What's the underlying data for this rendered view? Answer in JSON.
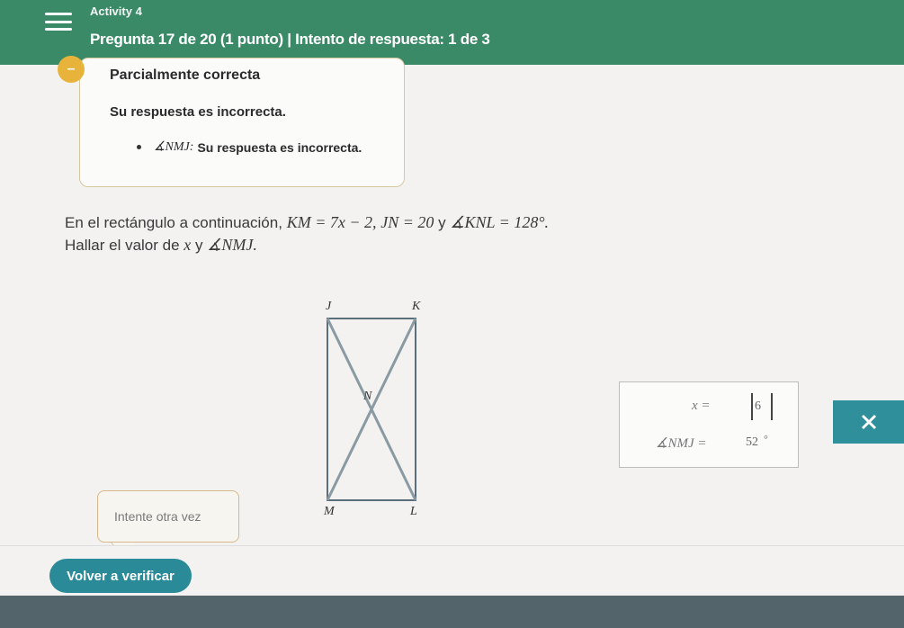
{
  "header": {
    "activity": "Activity 4",
    "question": "Pregunta 17 de 20 (1 punto)  |  Intento de respuesta: 1 de 3"
  },
  "feedback": {
    "title": "Parcialmente correcta",
    "message": "Su respuesta es incorrecta.",
    "item_angle": "∡NMJ:",
    "item_text": "Su respuesta es incorrecta."
  },
  "problem": {
    "line1_prefix": "En el rectángulo a continuación,",
    "eq1": "KM = 7x − 2,",
    "eq2": "JN = 20",
    "conj": "y",
    "eq3": "∡KNL = 128°.",
    "line2_prefix": "Hallar el valor de",
    "var_x": "x",
    "line2_conj": "y",
    "angle": "∡NMJ."
  },
  "diagram": {
    "labels": {
      "J": "J",
      "K": "K",
      "M": "M",
      "L": "L",
      "N": "N"
    }
  },
  "answer": {
    "x_label": "x  =",
    "x_value": "6",
    "angle_label": "∡NMJ  =",
    "angle_value": "52",
    "degree": "°"
  },
  "buttons": {
    "try_again": "Intente otra vez",
    "verify": "Volver a verificar"
  },
  "colors": {
    "header": "#3a8a68",
    "accent": "#2b8a98",
    "status": "#e8b33a"
  }
}
